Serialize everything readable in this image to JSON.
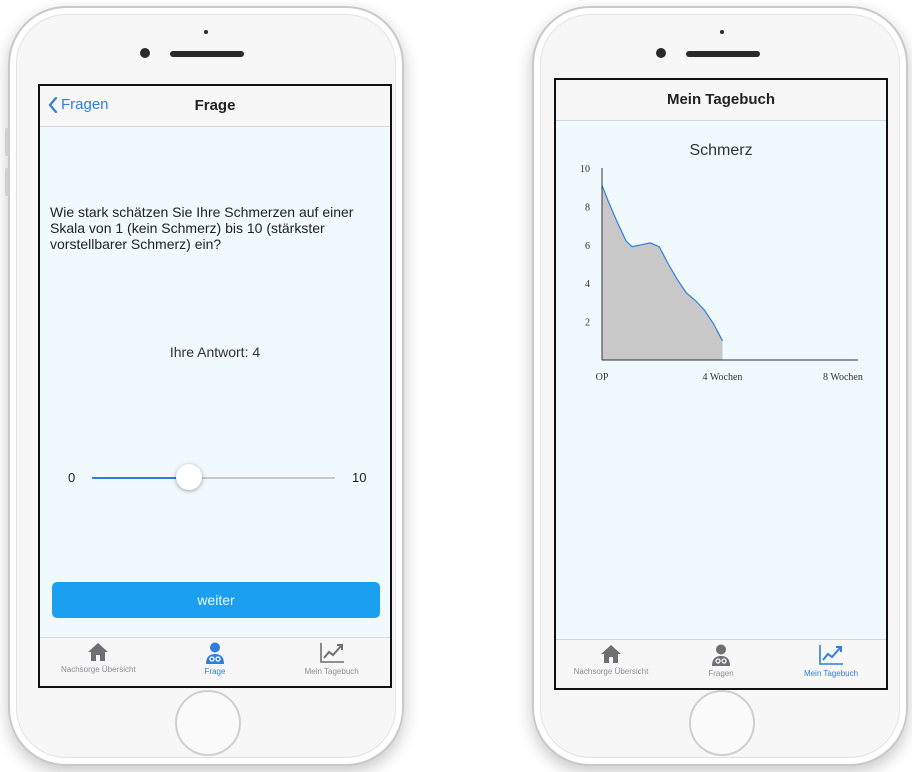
{
  "left_screen": {
    "nav": {
      "back_label": "Fragen",
      "title": "Frage"
    },
    "question_text": "Wie stark schätzen Sie Ihre Schmerzen auf einer Skala von 1 (kein Schmerz) bis 10 (stärkster vorstellbarer Schmerz) ein?",
    "answer_text": "Ihre Antwort: 4",
    "slider": {
      "min_label": "0",
      "max_label": "10",
      "min": 0,
      "max": 10,
      "value": 4
    },
    "continue_label": "weiter",
    "tabs": [
      {
        "label": "Nachsorge Übersicht",
        "icon": "home-icon",
        "active": false
      },
      {
        "label": "Frage",
        "icon": "doctor-icon",
        "active": true
      },
      {
        "label": "Mein Tagebuch",
        "icon": "chart-icon",
        "active": false
      }
    ]
  },
  "right_screen": {
    "nav": {
      "title": "Mein Tagebuch"
    },
    "tabs": [
      {
        "label": "Nachsorge Übersicht",
        "icon": "home-icon",
        "active": false
      },
      {
        "label": "Fragen",
        "icon": "doctor-icon",
        "active": false
      },
      {
        "label": "Mein Tagebuch",
        "icon": "chart-icon",
        "active": true
      }
    ]
  },
  "chart_data": {
    "type": "area",
    "title": "Schmerz",
    "x_tick_labels": [
      "OP",
      "4 Wochen",
      "8 Wochen"
    ],
    "x_ticks": [
      0,
      4,
      8
    ],
    "y_ticks": [
      2,
      4,
      6,
      8,
      10
    ],
    "y_tick_labels": [
      "2",
      "4",
      "6",
      "8",
      "10"
    ],
    "xlim": [
      0,
      8.5
    ],
    "ylim": [
      0,
      10
    ],
    "x": [
      0,
      0.2,
      0.5,
      0.8,
      1.0,
      1.3,
      1.6,
      1.9,
      2.2,
      2.5,
      2.8,
      3.1,
      3.4,
      3.7,
      4.0
    ],
    "y": [
      9.1,
      8.3,
      7.2,
      6.2,
      5.9,
      6.0,
      6.1,
      5.9,
      5.0,
      4.2,
      3.5,
      3.1,
      2.6,
      1.9,
      1.0
    ],
    "colors": {
      "fill": "#c8c8c8",
      "line": "#2f7de1",
      "axis": "#333333"
    }
  },
  "colors": {
    "accent": "#1b9ff0",
    "link": "#2f7de1",
    "screen_bg": "#f0f9fd"
  }
}
